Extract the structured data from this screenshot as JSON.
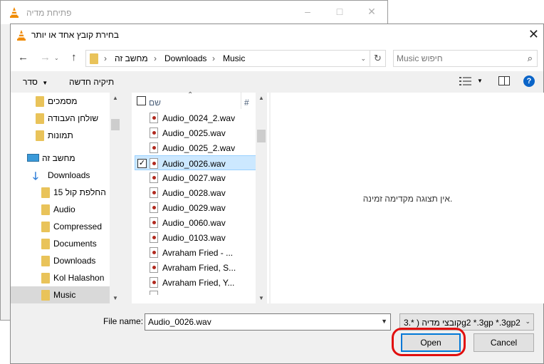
{
  "background_window": {
    "title": "פתיחת מדיה"
  },
  "dialog": {
    "title": "בחירת קובץ אחד או יותר",
    "close_glyph": "✕"
  },
  "address": {
    "segments": [
      "מחשב זה",
      "Downloads",
      "Music"
    ],
    "separator": "›",
    "back_glyph": "←",
    "forward_glyph": "→",
    "up_glyph": "↑",
    "refresh_glyph": "↻"
  },
  "search": {
    "placeholder": "חיפוש Music"
  },
  "toolbar": {
    "organize_label": "סדר",
    "new_folder_label": "תיקיה חדשה"
  },
  "nav_pane": {
    "items": [
      {
        "label": "מסמכים",
        "icon": "folder-icon"
      },
      {
        "label": "שולחן העבודה",
        "icon": "folder-icon"
      },
      {
        "label": "תמונות",
        "icon": "folder-icon"
      },
      {
        "label": "מחשב זה",
        "icon": "computer-icon"
      },
      {
        "label": "Downloads",
        "icon": "download-arrow-icon"
      },
      {
        "label": "החלפת קול 15",
        "icon": "folder-icon"
      },
      {
        "label": "Audio",
        "icon": "folder-icon"
      },
      {
        "label": "Compressed",
        "icon": "folder-icon"
      },
      {
        "label": "Documents",
        "icon": "folder-icon"
      },
      {
        "label": "Downloads",
        "icon": "folder-icon"
      },
      {
        "label": "Kol Halashon",
        "icon": "folder-icon"
      },
      {
        "label": "Music",
        "icon": "folder-icon",
        "selected": true
      }
    ]
  },
  "file_list": {
    "column_name": "שם",
    "column_num": "#",
    "files": [
      {
        "name": "Audio_0024_2.wav"
      },
      {
        "name": "Audio_0025.wav"
      },
      {
        "name": "Audio_0025_2.wav"
      },
      {
        "name": "Audio_0026.wav",
        "selected": true
      },
      {
        "name": "Audio_0027.wav"
      },
      {
        "name": "Audio_0028.wav"
      },
      {
        "name": "Audio_0029.wav"
      },
      {
        "name": "Audio_0060.wav"
      },
      {
        "name": "Audio_0103.wav"
      },
      {
        "name": "Avraham Fried - ..."
      },
      {
        "name": "Avraham Fried, S..."
      },
      {
        "name": "Avraham Fried, Y..."
      }
    ]
  },
  "preview": {
    "text": "אין תצוגה מקדימה זמינה."
  },
  "bottom": {
    "file_name_label": "File name:",
    "file_name_value": "Audio_0026.wav",
    "filter_value": "קובצי מדיה ( *.3g2 *.3gp *.3gp2",
    "open_label": "Open",
    "cancel_label": "Cancel"
  },
  "colors": {
    "annotation_ring": "#e10f0f",
    "selection": "#cce8ff",
    "help_icon": "#0a64c8"
  }
}
